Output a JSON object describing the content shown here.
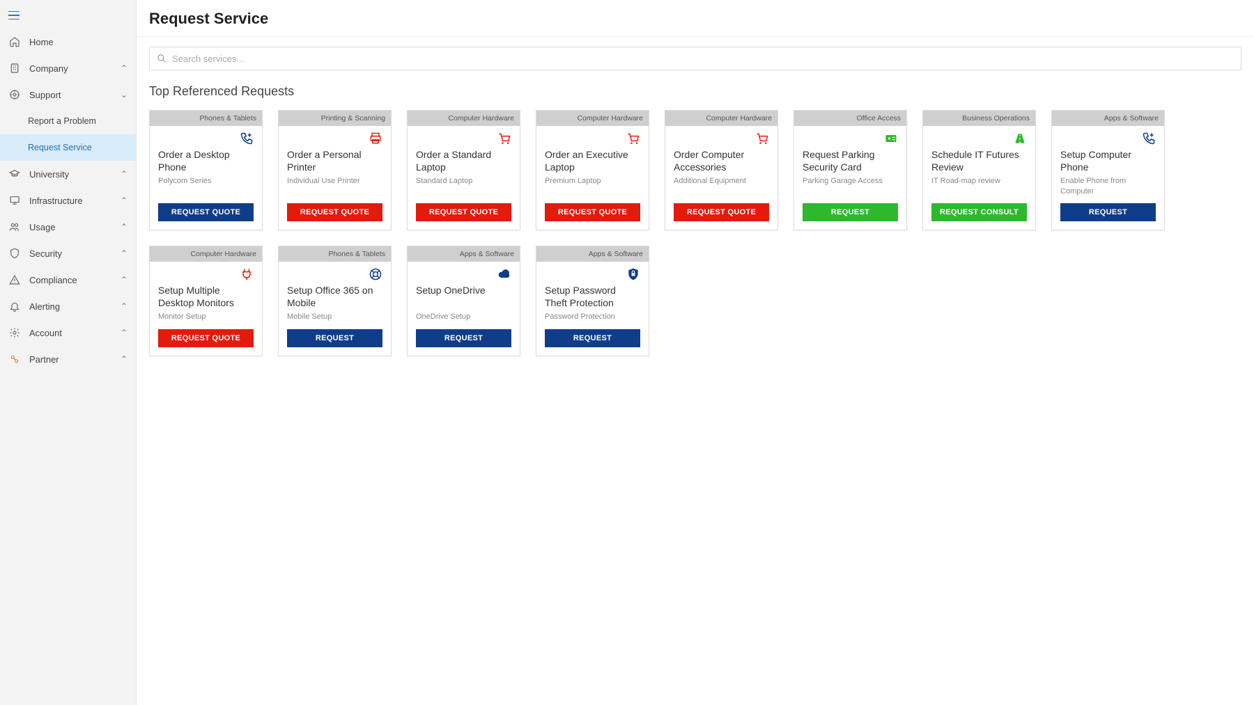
{
  "header": {
    "title": "Request Service"
  },
  "search": {
    "placeholder": "Search services..."
  },
  "section_title": "Top Referenced Requests",
  "buttons": {
    "quote": "REQUEST QUOTE",
    "request": "REQUEST",
    "consult": "REQUEST CONSULT"
  },
  "sidebar": {
    "items": [
      {
        "label": "Home",
        "icon": "home",
        "chevron": ""
      },
      {
        "label": "Company",
        "icon": "building",
        "chevron": "up"
      },
      {
        "label": "Support",
        "icon": "support",
        "chevron": "down"
      },
      {
        "label": "Report a Problem",
        "icon": "",
        "chevron": "",
        "sub": true
      },
      {
        "label": "Request Service",
        "icon": "",
        "chevron": "",
        "sub": true,
        "active": true
      },
      {
        "label": "University",
        "icon": "grad",
        "chevron": "up"
      },
      {
        "label": "Infrastructure",
        "icon": "monitor",
        "chevron": "up"
      },
      {
        "label": "Usage",
        "icon": "users",
        "chevron": "up"
      },
      {
        "label": "Security",
        "icon": "shield",
        "chevron": "up"
      },
      {
        "label": "Compliance",
        "icon": "warning",
        "chevron": "up"
      },
      {
        "label": "Alerting",
        "icon": "bell",
        "chevron": "up"
      },
      {
        "label": "Account",
        "icon": "gear",
        "chevron": "up"
      },
      {
        "label": "Partner",
        "icon": "partner",
        "chevron": "up",
        "partner": true
      }
    ]
  },
  "cards": [
    {
      "category": "Phones & Tablets",
      "title": "Order a Desktop Phone",
      "subtitle": "Polycom Series",
      "btn": "quote",
      "btn_color": "blue",
      "icon": "phone-add",
      "icon_color": "blue"
    },
    {
      "category": "Printing & Scanning",
      "title": "Order a Personal Printer",
      "subtitle": "Individual Use Printer",
      "btn": "quote",
      "btn_color": "red",
      "icon": "printer",
      "icon_color": "red"
    },
    {
      "category": "Computer Hardware",
      "title": "Order a Standard Laptop",
      "subtitle": "Standard Laptop",
      "btn": "quote",
      "btn_color": "red",
      "icon": "cart",
      "icon_color": "red"
    },
    {
      "category": "Computer Hardware",
      "title": "Order an Executive Laptop",
      "subtitle": "Premium Laptop",
      "btn": "quote",
      "btn_color": "red",
      "icon": "cart",
      "icon_color": "red"
    },
    {
      "category": "Computer Hardware",
      "title": "Order Computer Accessories",
      "subtitle": "Additional Equipment",
      "btn": "quote",
      "btn_color": "red",
      "icon": "cart",
      "icon_color": "red"
    },
    {
      "category": "Office Access",
      "title": "Request Parking Security Card",
      "subtitle": "Parking Garage Access",
      "btn": "request",
      "btn_color": "green",
      "icon": "idcard",
      "icon_color": "green"
    },
    {
      "category": "Business Operations",
      "title": "Schedule IT Futures Review",
      "subtitle": "IT Road-map review",
      "btn": "consult",
      "btn_color": "green",
      "icon": "road",
      "icon_color": "green"
    },
    {
      "category": "Apps & Software",
      "title": "Setup Computer Phone",
      "subtitle": "Enable Phone from Computer",
      "btn": "request",
      "btn_color": "blue",
      "icon": "phone-add",
      "icon_color": "blue"
    },
    {
      "category": "Computer Hardware",
      "title": "Setup Multiple Desktop Monitors",
      "subtitle": "Monitor Setup",
      "btn": "quote",
      "btn_color": "red",
      "icon": "plug",
      "icon_color": "red"
    },
    {
      "category": "Phones & Tablets",
      "title": "Setup Office 365 on Mobile",
      "subtitle": "Mobile Setup",
      "btn": "request",
      "btn_color": "blue",
      "icon": "lifesaver",
      "icon_color": "blue"
    },
    {
      "category": "Apps & Software",
      "title": "Setup OneDrive",
      "subtitle": "OneDrive Setup",
      "btn": "request",
      "btn_color": "blue",
      "icon": "cloud",
      "icon_color": "blue"
    },
    {
      "category": "Apps & Software",
      "title": "Setup Password Theft Protection",
      "subtitle": "Password Protection",
      "btn": "request",
      "btn_color": "blue",
      "icon": "shield-lock",
      "icon_color": "blue"
    }
  ]
}
